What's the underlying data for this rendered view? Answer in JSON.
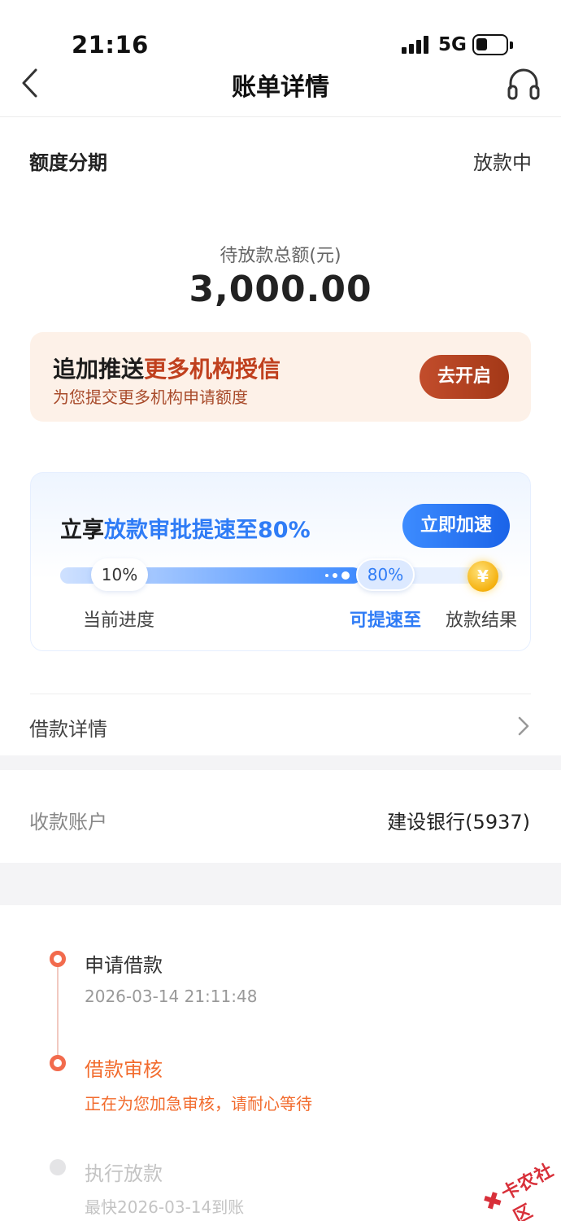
{
  "status_bar": {
    "time": "21:16",
    "network": "5G"
  },
  "nav": {
    "title": "账单详情"
  },
  "product": {
    "name": "额度分期",
    "status": "放款中"
  },
  "amount": {
    "label": "待放款总额(元)",
    "value": "3,000.00"
  },
  "push_card": {
    "title_prefix": "追加推送",
    "title_highlight": "更多机构授信",
    "subtitle": "为您提交更多机构申请额度",
    "button": "去开启"
  },
  "speed_card": {
    "title_prefix": "立享",
    "title_highlight": "放款审批提速至80%",
    "button": "立即加速",
    "current_percent": "10%",
    "target_percent": "80%",
    "current_label": "当前进度",
    "target_label": "可提速至",
    "result_label": "放款结果",
    "progress_fill_fraction": 0.68
  },
  "loan_detail": {
    "label": "借款详情"
  },
  "account": {
    "label": "收款账户",
    "value": "建设银行(5937)"
  },
  "timeline": [
    {
      "title": "申请借款",
      "subtitle": "2026-03-14 21:11:48",
      "state": "active"
    },
    {
      "title": "借款审核",
      "subtitle": "正在为您加急审核，请耐心等待",
      "state": "current"
    },
    {
      "title": "执行放款",
      "subtitle": "最快2026-03-14到账",
      "state": "pending"
    }
  ],
  "watermark": {
    "text": "卡农社区"
  },
  "colors": {
    "accent_orange": "#f26b4d",
    "accent_blue": "#2f7cf6",
    "accent_red_brown": "#c0401e"
  }
}
